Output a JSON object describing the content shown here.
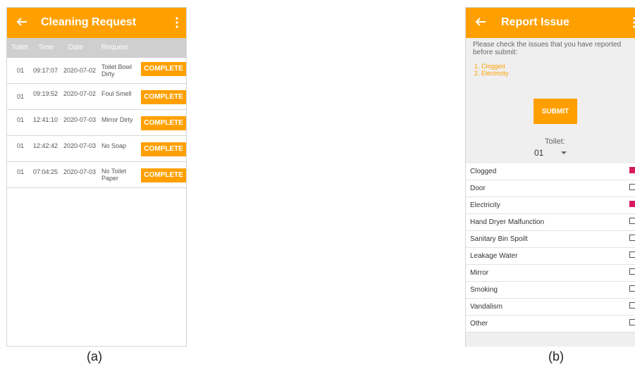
{
  "panel_a": {
    "title": "Cleaning Request",
    "columns": [
      "Toilet",
      "Time",
      "Date",
      "Request"
    ],
    "rows": [
      {
        "toilet": "01",
        "time": "09:17:07",
        "date": "2020-07-02",
        "request": "Toilet Bowl Dirty",
        "action": "COMPLETE"
      },
      {
        "toilet": "01",
        "time": "09:19:52",
        "date": "2020-07-02",
        "request": "Foul Smell",
        "action": "COMPLETE"
      },
      {
        "toilet": "01",
        "time": "12:41:10",
        "date": "2020-07-03",
        "request": "Mirror Dirty",
        "action": "COMPLETE"
      },
      {
        "toilet": "01",
        "time": "12:42:42",
        "date": "2020-07-03",
        "request": "No Soap",
        "action": "COMPLETE"
      },
      {
        "toilet": "01",
        "time": "07:04:25",
        "date": "2020-07-03",
        "request": "No Toilet Paper",
        "action": "COMPLETE"
      }
    ],
    "caption": "(a)"
  },
  "panel_b": {
    "title": "Report Issue",
    "instructions": "Please check the issues that you have reported before submit:",
    "reported": [
      "1. Clogged",
      "2. Electricity"
    ],
    "submit_label": "SUBMIT",
    "toilet_label": "Toilet:",
    "toilet_value": "01",
    "issues": [
      {
        "label": "Clogged",
        "checked": true
      },
      {
        "label": "Door",
        "checked": false
      },
      {
        "label": "Electricity",
        "checked": true
      },
      {
        "label": "Hand Dryer Malfunction",
        "checked": false
      },
      {
        "label": "Sanitary Bin Spoilt",
        "checked": false
      },
      {
        "label": "Leakage Water",
        "checked": false
      },
      {
        "label": "Mirror",
        "checked": false
      },
      {
        "label": "Smoking",
        "checked": false
      },
      {
        "label": "Vandalism",
        "checked": false
      },
      {
        "label": "Other",
        "checked": false
      }
    ],
    "caption": "(b)"
  },
  "colors": {
    "accent": "#ffa000",
    "check": "#d81b60",
    "header_gray": "#cfcfcf"
  },
  "icons": {
    "back": "arrow-left-icon",
    "menu": "more-vert-icon",
    "dropdown": "caret-down-icon",
    "checkbox": "checkbox-icon"
  }
}
